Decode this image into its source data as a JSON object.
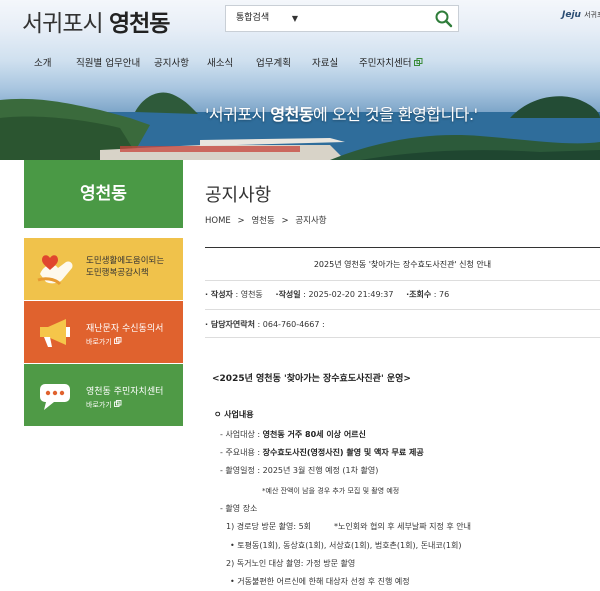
{
  "header": {
    "site_prefix": "서귀포시 ",
    "site_name": "영천동",
    "search_scope": "통합검색",
    "search_value": "",
    "jeju_logo": "Jeju",
    "jeju_sub": "서귀포시"
  },
  "nav": [
    {
      "label": "소개"
    },
    {
      "label": "직원별 업무안내"
    },
    {
      "label": "공지사항"
    },
    {
      "label": "새소식"
    },
    {
      "label": "업무계획"
    },
    {
      "label": "자료실"
    },
    {
      "label": "주민자치센터"
    }
  ],
  "banner": {
    "welcome_pre": "'서귀포시 ",
    "welcome_bold": "영천동",
    "welcome_post": "에 오신 것을 환영합니다.'"
  },
  "side": {
    "title": "영천동",
    "cards": [
      {
        "line1": "도민생활에도움이되는",
        "line2": "도민행복공감시책"
      },
      {
        "title": "재난문자 수신동의서",
        "more": "바로가기"
      },
      {
        "title": "영천동 주민자치센터",
        "more": "바로가기"
      }
    ]
  },
  "main": {
    "page_title": "공지사항",
    "breadcrumb": [
      "HOME",
      ">",
      "영천동",
      ">",
      "공지사항"
    ],
    "post": {
      "title": "2025년 영천동 '찾아가는 장수효도사진관' 신청 안내",
      "author_label": "작성자",
      "author": "영천동",
      "date_label": "작성일",
      "date": "2025-02-20 21:49:37",
      "views_label": "조회수",
      "views": "76",
      "contact_label": "담당자연락처",
      "contact": "064-760-4667"
    },
    "content": {
      "headline": "<2025년 영천동 '찾아가는 장수효도사진관' 운영>",
      "section": "사업내용",
      "target_label": "사업대상 : ",
      "target": "영천동 거주 80세 이상 어르신",
      "content_label": "주요내용 : ",
      "content": "장수효도사진(영정사진) 촬영 및 액자 무료 제공",
      "schedule": "- 촬영일정 : 2025년 3월 진행 예정 (1차 촬영)",
      "note": "*예산 잔액이 남을 경우 추가 모집 및 촬영 예정",
      "place": "- 촬영 장소",
      "place1": "1) 경로당 방문 촬영: 5회",
      "place1_note": "*노인회와 협의 후 세부날짜 지정 후 안내",
      "place1_list": "• 토평동(1회), 동상효(1회), 서상효(1회), 법호촌(1회), 돈내코(1회)",
      "place2": "2) 독거노인 대상 촬영: 가정 방문 촬영",
      "place2_list": "• 거동불편한 어르신에 한해 대상자 선정 후 진행 예정"
    }
  },
  "colors": {
    "green": "#4a9945",
    "yellow": "#f0c24b",
    "orange": "#e0622e",
    "green2": "#4f9a46"
  }
}
